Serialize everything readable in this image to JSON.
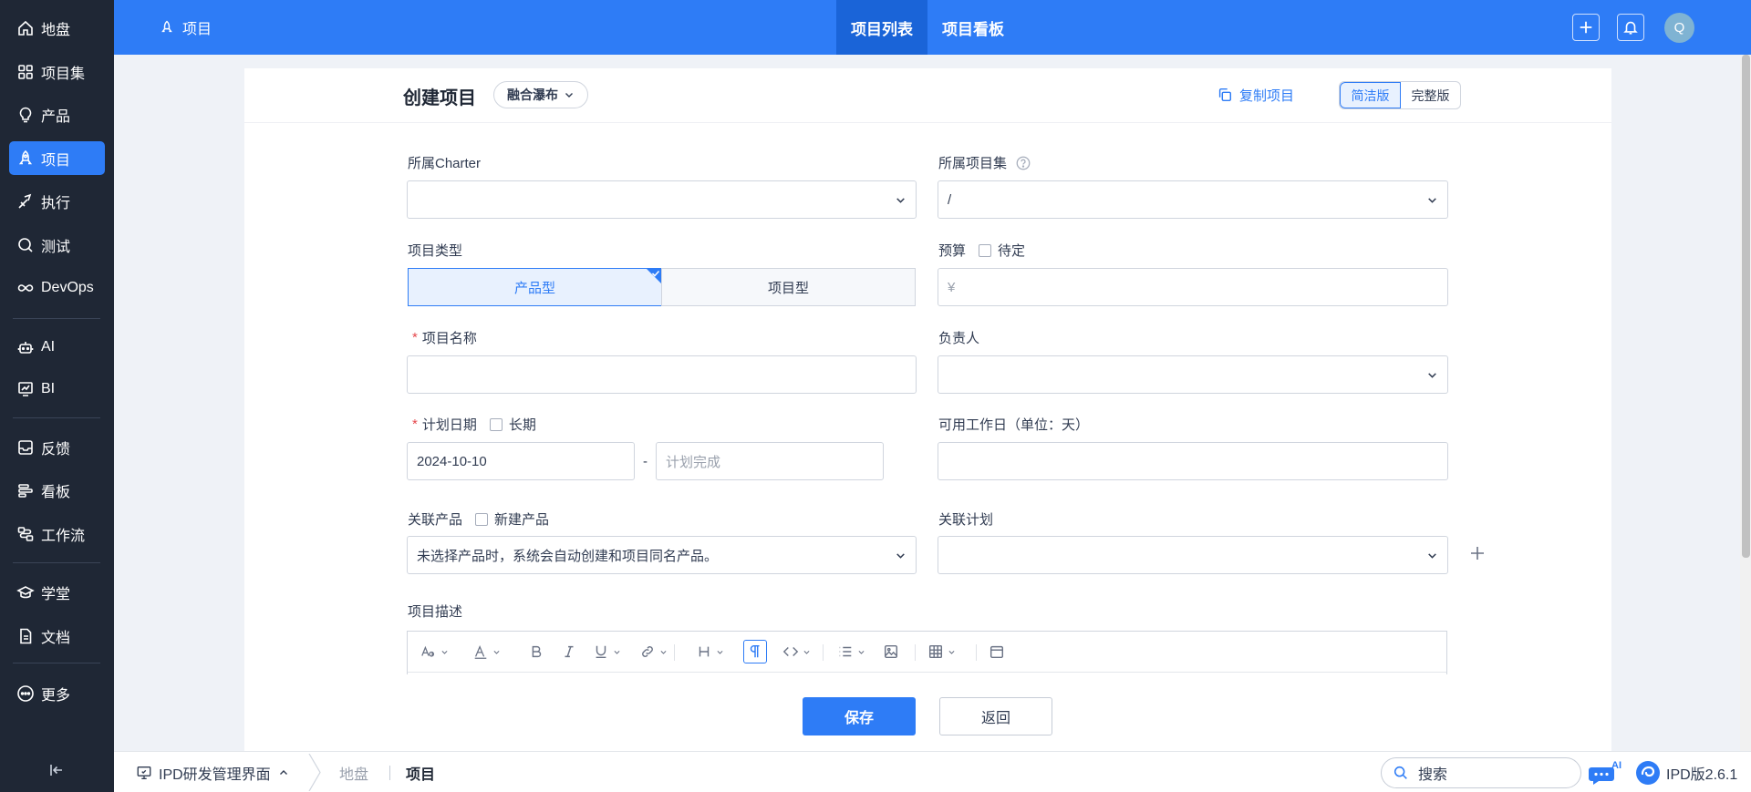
{
  "sidebar": {
    "items": [
      {
        "label": "地盘",
        "icon": "home-icon"
      },
      {
        "label": "项目集",
        "icon": "grid-icon"
      },
      {
        "label": "产品",
        "icon": "bulb-icon"
      },
      {
        "label": "项目",
        "icon": "rocket-icon"
      },
      {
        "label": "执行",
        "icon": "run-icon"
      },
      {
        "label": "测试",
        "icon": "magnifier-icon"
      },
      {
        "label": "DevOps",
        "icon": "infinity-icon"
      },
      {
        "label": "AI",
        "icon": "robot-icon"
      },
      {
        "label": "BI",
        "icon": "chart-icon"
      },
      {
        "label": "反馈",
        "icon": "inbox-icon"
      },
      {
        "label": "看板",
        "icon": "kanban-icon"
      },
      {
        "label": "工作流",
        "icon": "workflow-icon"
      },
      {
        "label": "学堂",
        "icon": "graduation-icon"
      },
      {
        "label": "文档",
        "icon": "document-icon"
      },
      {
        "label": "更多",
        "icon": "more-icon"
      }
    ],
    "active": "项目"
  },
  "topbar": {
    "section": "项目",
    "tabs": [
      {
        "label": "项目列表",
        "active": true
      },
      {
        "label": "项目看板",
        "active": false
      }
    ],
    "avatar": "Q"
  },
  "page": {
    "title": "创建项目",
    "mode": "融合瀑布",
    "copy_label": "复制项目",
    "versions": [
      "简洁版",
      "完整版"
    ],
    "active_version": "简洁版"
  },
  "form": {
    "charter_label": "所属Charter",
    "charter_value": "",
    "program_label": "所属项目集",
    "program_value": "/",
    "type_label": "项目类型",
    "type_options": [
      "产品型",
      "项目型"
    ],
    "type_selected": "产品型",
    "budget_label": "预算",
    "budget_pending": "待定",
    "budget_placeholder": "¥",
    "name_label": "项目名称",
    "owner_label": "负责人",
    "date_label": "计划日期",
    "long_term": "长期",
    "begin_date": "2024-10-10",
    "end_placeholder": "计划完成",
    "date_separator": "-",
    "workdays_label": "可用工作日（单位：天）",
    "product_label": "关联产品",
    "new_product": "新建产品",
    "product_hint": "未选择产品时，系统会自动创建和项目同名产品。",
    "plan_label": "关联计划",
    "desc_label": "项目描述"
  },
  "actions": {
    "save": "保存",
    "back": "返回"
  },
  "bottombar": {
    "app": "IPD研发管理界面",
    "crumbs": [
      "地盘",
      "项目"
    ],
    "search_placeholder": "搜索",
    "ai_badge": "AI",
    "brand": "IPD版2.6.1"
  },
  "colors": {
    "primary": "#2e7cf6",
    "sidebar_bg": "#1f2735",
    "required": "#e5484d"
  }
}
